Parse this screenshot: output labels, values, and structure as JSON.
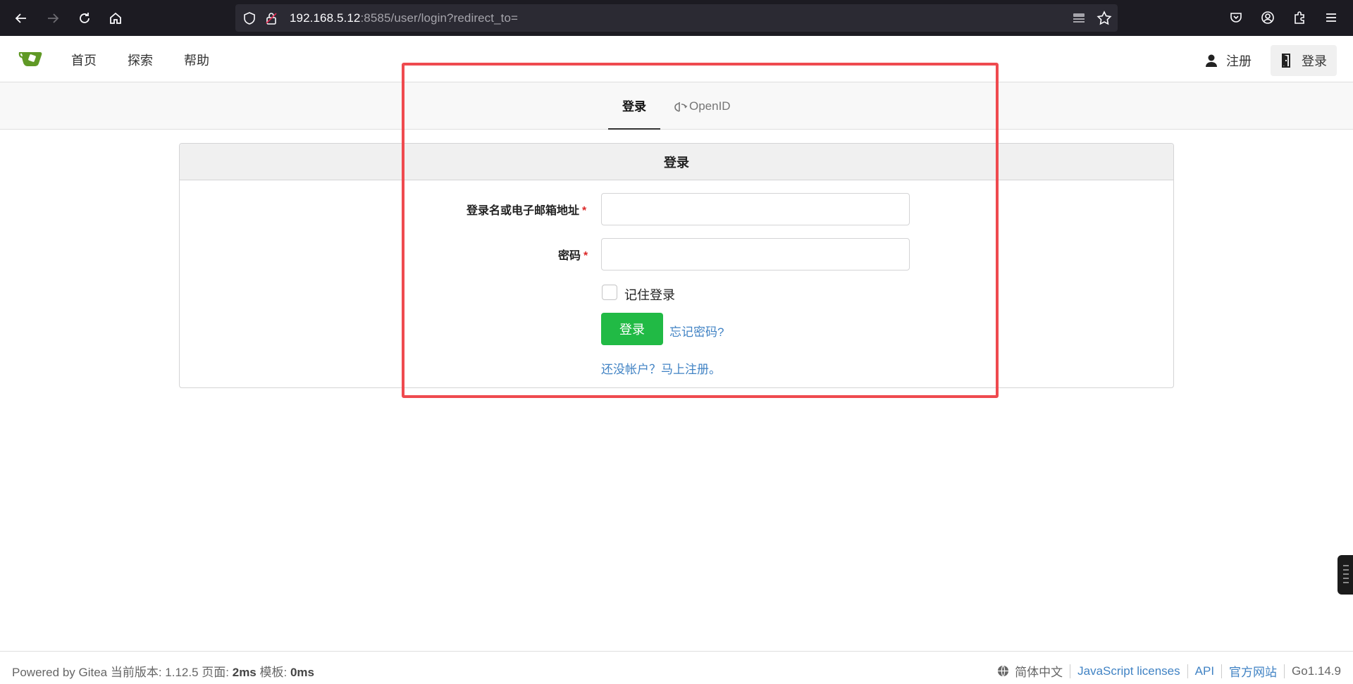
{
  "browser": {
    "url_host": "192.168.5.12",
    "url_path": ":8585/user/login?redirect_to="
  },
  "nav": {
    "items": [
      "首页",
      "探索",
      "帮助"
    ],
    "register_label": "注册",
    "login_label": "登录"
  },
  "tabs": {
    "login": "登录",
    "openid": "OpenID"
  },
  "form": {
    "title": "登录",
    "username_label": "登录名或电子邮箱地址",
    "username_value": "",
    "password_label": "密码",
    "password_value": "",
    "required_mark": "*",
    "remember_label": "记住登录",
    "remember_checked": false,
    "submit_label": "登录",
    "forgot_label": "忘记密码?",
    "signup_label": "还没帐户？马上注册。"
  },
  "footer": {
    "powered": "Powered by Gitea 当前版本: 1.12.5 页面: ",
    "page_time": "2ms",
    "template_label": " 模板: ",
    "template_time": "0ms",
    "language": "简体中文",
    "js_licenses": "JavaScript licenses",
    "api": "API",
    "website": "官方网站",
    "go_version": "Go1.14.9"
  },
  "colors": {
    "accent_green": "#21ba45",
    "link_blue": "#4183c4",
    "highlight_red": "#ef4a4f",
    "required_red": "#db2828"
  }
}
